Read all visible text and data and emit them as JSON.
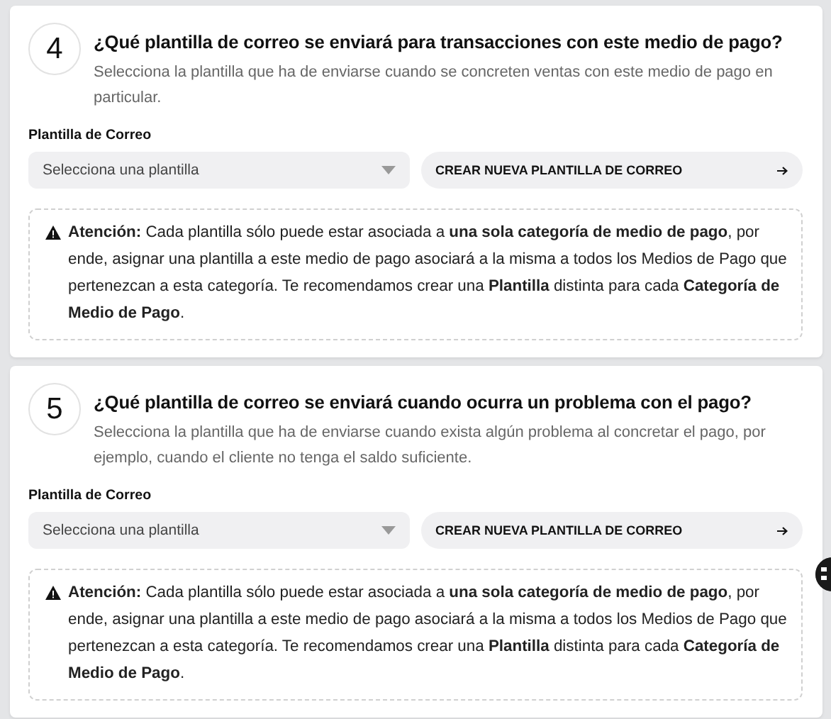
{
  "steps": [
    {
      "number": "4",
      "title": "¿Qué plantilla de correo se enviará para transacciones con este medio de pago?",
      "description": "Selecciona la plantilla que ha de enviarse cuando se concreten ventas con este medio de pago en particular.",
      "field_label": "Plantilla de Correo",
      "select": {
        "placeholder": "Selecciona una plantilla"
      },
      "create_button": "CREAR NUEVA PLANTILLA DE CORREO",
      "notice": "**Atención:** Cada plantilla sólo puede estar asociada a **una sola categoría de medio de pago**, por ende, asignar una plantilla a este medio de pago asociará a la misma a todos los Medios de Pago que pertenezcan a esta categoría. Te recomendamos crear una **Plantilla** distinta para cada **Categoría de Medio de Pago**."
    },
    {
      "number": "5",
      "title": "¿Qué plantilla de correo se enviará cuando ocurra un problema con el pago?",
      "description": "Selecciona la plantilla que ha de enviarse cuando exista algún problema al concretar el pago, por ejemplo, cuando el cliente no tenga el saldo suficiente.",
      "field_label": "Plantilla de Correo",
      "select": {
        "placeholder": "Selecciona una plantilla"
      },
      "create_button": "CREAR NUEVA PLANTILLA DE CORREO",
      "notice": "**Atención:** Cada plantilla sólo puede estar asociada a **una sola categoría de medio de pago**, por ende, asignar una plantilla a este medio de pago asociará a la misma a todos los Medios de Pago que pertenezcan a esta categoría. Te recomendamos crear una **Plantilla** distinta para cada **Categoría de Medio de Pago**."
    }
  ]
}
